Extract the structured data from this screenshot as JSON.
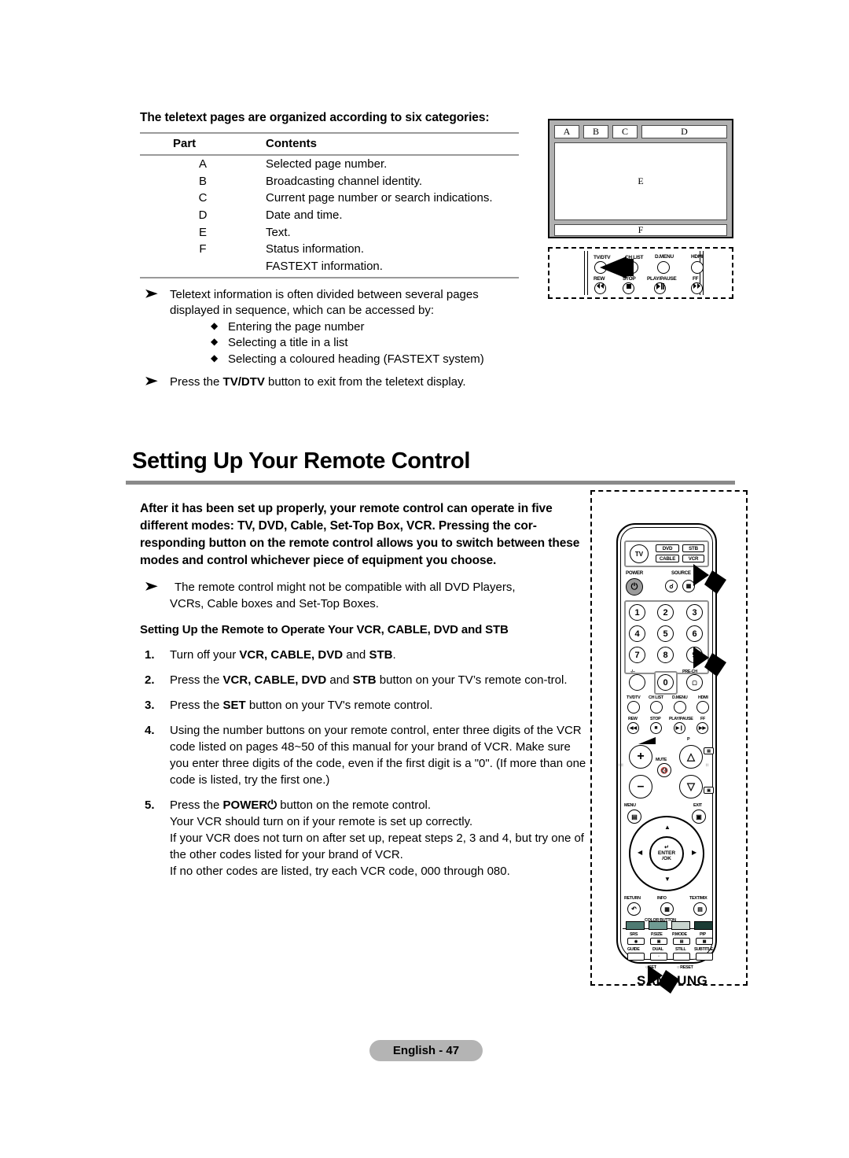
{
  "teletext_section": {
    "heading": "The teletext pages are organized according to six categories:",
    "table": {
      "headers": [
        "Part",
        "Contents"
      ],
      "rows": [
        {
          "part": "A",
          "contents": "Selected page number."
        },
        {
          "part": "B",
          "contents": "Broadcasting channel identity."
        },
        {
          "part": "C",
          "contents": "Current page number or search indications."
        },
        {
          "part": "D",
          "contents": "Date and time."
        },
        {
          "part": "E",
          "contents": "Text."
        },
        {
          "part": "F",
          "contents": "Status information."
        },
        {
          "part": "",
          "contents": "FASTEXT information."
        }
      ]
    },
    "notes": {
      "note1_line1": "Teletext information is often divided between several pages",
      "note1_line2": "displayed in sequence, which can be accessed by:",
      "sub_bullets": [
        "Entering the page number",
        "Selecting a title in a list",
        "Selecting a coloured heading (FASTEXT system)"
      ],
      "note2_pre": "Press the ",
      "note2_bold": "TV/DTV",
      "note2_post": " button to exit from the teletext display."
    }
  },
  "teletext_diagram": {
    "cells": {
      "a": "A",
      "b": "B",
      "c": "C",
      "d": "D",
      "e": "E",
      "f": "F"
    }
  },
  "remote_fragment": {
    "labels_top": [
      "TV/DTV",
      "CH LIST",
      "D.MENU",
      "HDMI"
    ],
    "labels_bottom": [
      "REW",
      "STOP",
      "PLAY/PAUSE",
      "FF"
    ]
  },
  "section": {
    "title": "Setting Up Your Remote Control",
    "intro_bold": "After it has been set up properly, your remote control can operate in five different modes: TV, DVD, Cable, Set-Top Box, VCR. Pressing the cor-responding button on the remote control allows you to switch between these modes and control whichever piece of equipment you choose.",
    "note_line1": "The remote control might not be compatible with all DVD Players,",
    "note_line2": "VCRs, Cable boxes and Set-Top Boxes.",
    "sub_heading": "Setting Up the Remote to Operate Your VCR, CABLE, DVD and STB",
    "steps": [
      {
        "num": "1.",
        "parts": [
          {
            "t": "Turn off your ",
            "b": false
          },
          {
            "t": "VCR, CABLE, DVD",
            "b": true
          },
          {
            "t": " and ",
            "b": false
          },
          {
            "t": "STB",
            "b": true
          },
          {
            "t": ".",
            "b": false
          }
        ]
      },
      {
        "num": "2.",
        "parts": [
          {
            "t": "Press the ",
            "b": false
          },
          {
            "t": "VCR, CABLE, DVD",
            "b": true
          },
          {
            "t": " and ",
            "b": false
          },
          {
            "t": "STB",
            "b": true
          },
          {
            "t": " button on your TV’s remote con-trol.",
            "b": false
          }
        ]
      },
      {
        "num": "3.",
        "parts": [
          {
            "t": "Press the ",
            "b": false
          },
          {
            "t": "SET",
            "b": true
          },
          {
            "t": " button on your TV's remote control.",
            "b": false
          }
        ]
      },
      {
        "num": "4.",
        "parts": [
          {
            "t": "Using the number buttons on your remote control, enter three digits of the VCR code listed on pages 48~50 of this manual for your brand of VCR. Make sure you enter three digits of the code, even if the first digit is a \"0\". (If more than one code is listed, try the first one.)",
            "b": false
          }
        ]
      },
      {
        "num": "5.",
        "parts": [
          {
            "t": "Press the ",
            "b": false
          },
          {
            "t": "POWER⏻",
            "b": true
          },
          {
            "t": " button on the remote control.",
            "b": false
          },
          {
            "t": "\nYour VCR should turn on if your remote is set up correctly.\nIf your VCR does not turn on after set up, repeat steps 2, 3 and 4, but try one of the other codes listed for your brand of VCR.\nIf no other codes are listed, try each VCR code, 000 through 080.",
            "b": false
          }
        ]
      }
    ]
  },
  "remote": {
    "mode_buttons": [
      "TV",
      "DVD",
      "STB",
      "CABLE",
      "VCR"
    ],
    "power_label": "POWER",
    "source_label": "SOURCE",
    "numbers": [
      "1",
      "2",
      "3",
      "4",
      "5",
      "6",
      "7",
      "8",
      "9",
      "0"
    ],
    "prech_label": "PRE-CH",
    "minus_label": "-/--",
    "row_tvdtv": [
      "TV/DTV",
      "CH LIST",
      "D.MENU",
      "HDMI"
    ],
    "row_transport": [
      "REW",
      "STOP",
      "PLAY/PAUSE",
      "FF"
    ],
    "mute_label": "MUTE",
    "p_label": "P",
    "menu_label": "MENU",
    "exit_label": "EXIT",
    "enter_label": "ENTER",
    "ok_label": "/OK",
    "return_label": "RETURN",
    "info_label": "INFO",
    "textmix_label": "TEXT/MIX",
    "color_button_label": "COLOR BUTTON",
    "function_row1": [
      "SRS",
      "P.SIZE",
      "P.MODE",
      "PIP"
    ],
    "function_row2": [
      "GUIDE",
      "DUAL",
      "STILL",
      "SUBTITLE"
    ],
    "set_label": "SET",
    "reset_label": "RESET",
    "brand": "SAMSUNG",
    "colors": {
      "red": "#4f7a72",
      "green": "#6f9a92",
      "yellow": "#c9d4ce",
      "blue": "#1b3b34",
      "group_outline": "#8f8f8f",
      "power_fill": "#9b9b9b"
    }
  },
  "footer": {
    "page_label": "English - 47"
  }
}
